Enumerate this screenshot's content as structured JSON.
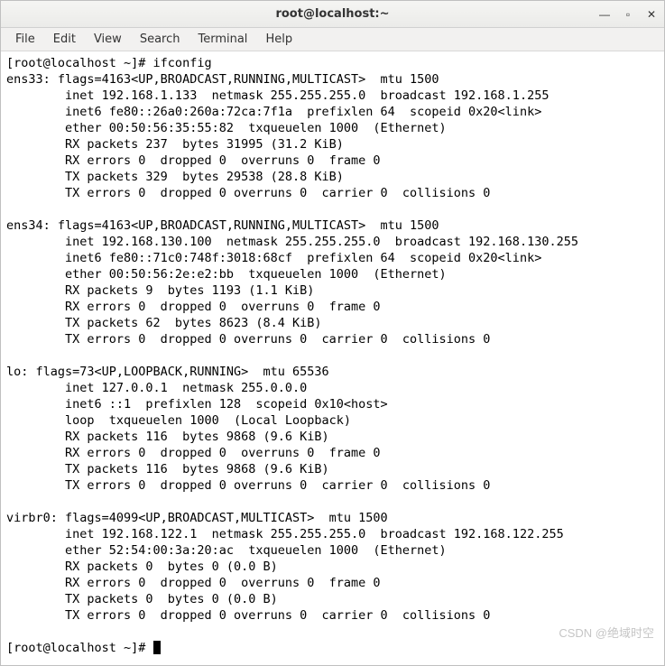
{
  "window": {
    "title": "root@localhost:~"
  },
  "window_controls": {
    "minimize": "—",
    "maximize": "▫",
    "close": "✕"
  },
  "menu": {
    "file": "File",
    "edit": "Edit",
    "view": "View",
    "search": "Search",
    "terminal": "Terminal",
    "help": "Help"
  },
  "terminal": {
    "prompt1": "[root@localhost ~]# ",
    "command1": "ifconfig",
    "output_lines": [
      "ens33: flags=4163<UP,BROADCAST,RUNNING,MULTICAST>  mtu 1500",
      "        inet 192.168.1.133  netmask 255.255.255.0  broadcast 192.168.1.255",
      "        inet6 fe80::26a0:260a:72ca:7f1a  prefixlen 64  scopeid 0x20<link>",
      "        ether 00:50:56:35:55:82  txqueuelen 1000  (Ethernet)",
      "        RX packets 237  bytes 31995 (31.2 KiB)",
      "        RX errors 0  dropped 0  overruns 0  frame 0",
      "        TX packets 329  bytes 29538 (28.8 KiB)",
      "        TX errors 0  dropped 0 overruns 0  carrier 0  collisions 0",
      "",
      "ens34: flags=4163<UP,BROADCAST,RUNNING,MULTICAST>  mtu 1500",
      "        inet 192.168.130.100  netmask 255.255.255.0  broadcast 192.168.130.255",
      "        inet6 fe80::71c0:748f:3018:68cf  prefixlen 64  scopeid 0x20<link>",
      "        ether 00:50:56:2e:e2:bb  txqueuelen 1000  (Ethernet)",
      "        RX packets 9  bytes 1193 (1.1 KiB)",
      "        RX errors 0  dropped 0  overruns 0  frame 0",
      "        TX packets 62  bytes 8623 (8.4 KiB)",
      "        TX errors 0  dropped 0 overruns 0  carrier 0  collisions 0",
      "",
      "lo: flags=73<UP,LOOPBACK,RUNNING>  mtu 65536",
      "        inet 127.0.0.1  netmask 255.0.0.0",
      "        inet6 ::1  prefixlen 128  scopeid 0x10<host>",
      "        loop  txqueuelen 1000  (Local Loopback)",
      "        RX packets 116  bytes 9868 (9.6 KiB)",
      "        RX errors 0  dropped 0  overruns 0  frame 0",
      "        TX packets 116  bytes 9868 (9.6 KiB)",
      "        TX errors 0  dropped 0 overruns 0  carrier 0  collisions 0",
      "",
      "virbr0: flags=4099<UP,BROADCAST,MULTICAST>  mtu 1500",
      "        inet 192.168.122.1  netmask 255.255.255.0  broadcast 192.168.122.255",
      "        ether 52:54:00:3a:20:ac  txqueuelen 1000  (Ethernet)",
      "        RX packets 0  bytes 0 (0.0 B)",
      "        RX errors 0  dropped 0  overruns 0  frame 0",
      "        TX packets 0  bytes 0 (0.0 B)",
      "        TX errors 0  dropped 0 overruns 0  carrier 0  collisions 0",
      ""
    ],
    "prompt2": "[root@localhost ~]# "
  },
  "watermark": "CSDN @绝域时空"
}
